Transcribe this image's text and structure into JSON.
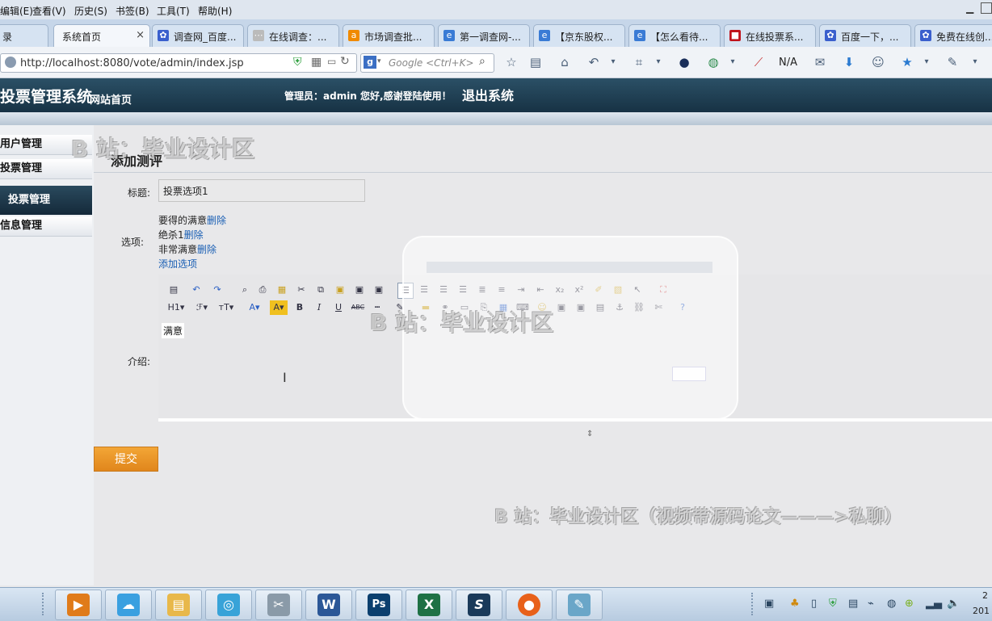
{
  "browser": {
    "menu": [
      "编辑(E)",
      "查看(V)",
      "历史(S)",
      "书签(B)",
      "工具(T)",
      "帮助(H)"
    ],
    "tabs": [
      {
        "label": "录",
        "icon": "page-icon",
        "color": "#888888"
      },
      {
        "label": "系统首页",
        "icon": "",
        "color": "#888888",
        "close": "×"
      },
      {
        "label": "调查网_百度...",
        "icon": "paw-icon",
        "color": "#3a5fcd"
      },
      {
        "label": "在线调查：...",
        "icon": "loading-icon",
        "color": "#999999"
      },
      {
        "label": "市场调查批...",
        "icon": "alibaba-icon",
        "color": "#f08a00"
      },
      {
        "label": "第一调查网-...",
        "icon": "ie-icon",
        "color": "#3a7bd5"
      },
      {
        "label": "【京东股权...",
        "icon": "ie-icon",
        "color": "#3a7bd5"
      },
      {
        "label": "【怎么看待...",
        "icon": "ie-icon",
        "color": "#3a7bd5"
      },
      {
        "label": "在线投票系...",
        "icon": "vote-icon",
        "color": "#c0131b"
      },
      {
        "label": "百度一下，...",
        "icon": "paw-icon",
        "color": "#3a5fcd"
      },
      {
        "label": "免费在线创...",
        "icon": "paw-icon",
        "color": "#3a5fcd"
      }
    ],
    "url": "http://localhost:8080/vote/admin/index.jsp",
    "search_placeholder": "Google <Ctrl+K>",
    "na_label": "N/A"
  },
  "app": {
    "title": "投票管理系统",
    "home_link": "网站首页",
    "greeting": "管理员：admin 您好,感谢登陆使用！",
    "logout": "退出系统"
  },
  "sidebar": {
    "items": [
      "用户管理",
      "投票管理",
      "投票管理",
      "信息管理"
    ]
  },
  "form": {
    "heading": "添加测评",
    "title_label": "标题:",
    "title_value": "投票选项1",
    "options_label": "选项:",
    "options": [
      {
        "text": "要得的满意",
        "delete": "删除"
      },
      {
        "text": "绝杀1",
        "delete": "删除"
      },
      {
        "text": "非常满意",
        "delete": "删除"
      }
    ],
    "add_option": "添加选项",
    "intro_label": "介绍:",
    "editor_content": "满意",
    "submit": "提交"
  },
  "watermarks": [
    "B 站：毕业设计区",
    "B 站：毕业设计区",
    "B 站：毕业设计区（视频带源码论文———>私聊）"
  ],
  "taskbar": {
    "apps": [
      {
        "icon": "media-player-icon",
        "color": "#e07b1a",
        "glyph": "▶"
      },
      {
        "icon": "cloud-icon",
        "color": "#3aa0e0",
        "glyph": "☁"
      },
      {
        "icon": "folder-icon",
        "color": "#e8b84a",
        "glyph": "▤"
      },
      {
        "icon": "qq-browser-icon",
        "color": "#38a3d8",
        "glyph": "◎"
      },
      {
        "icon": "tools-icon",
        "color": "#8a9aa8",
        "glyph": "✂"
      },
      {
        "icon": "word-icon",
        "color": "#2b5797",
        "glyph": "W"
      },
      {
        "icon": "photoshop-icon",
        "color": "#0b3f6e",
        "glyph": "Ps"
      },
      {
        "icon": "excel-icon",
        "color": "#1e7145",
        "glyph": "X"
      },
      {
        "icon": "app-s-icon",
        "color": "#1a3a5a",
        "glyph": "S"
      },
      {
        "icon": "firefox-icon",
        "color": "#e8611a",
        "glyph": "●"
      },
      {
        "icon": "notepad-icon",
        "color": "#6aa6c8",
        "glyph": "✎"
      }
    ],
    "clock_top": "2",
    "clock_bottom": "201"
  }
}
